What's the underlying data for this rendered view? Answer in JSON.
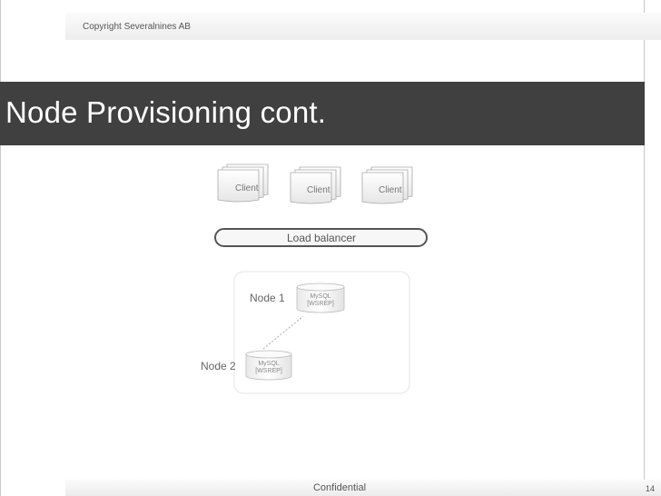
{
  "header": {
    "copyright": "Copyright Severalnines AB"
  },
  "slide": {
    "title": "Node Provisioning cont."
  },
  "diagram": {
    "clients": [
      "Client",
      "Client",
      "Client"
    ],
    "load_balancer": "Load balancer",
    "node1": {
      "label": "Node 1",
      "db_line1": "MySQL",
      "db_line2": "[WSREP]"
    },
    "node2": {
      "label": "Node 2",
      "db_line1": "MySQL",
      "db_line2": "[WSREP]"
    }
  },
  "footer": {
    "confidential": "Confidential",
    "page_number": "14"
  }
}
